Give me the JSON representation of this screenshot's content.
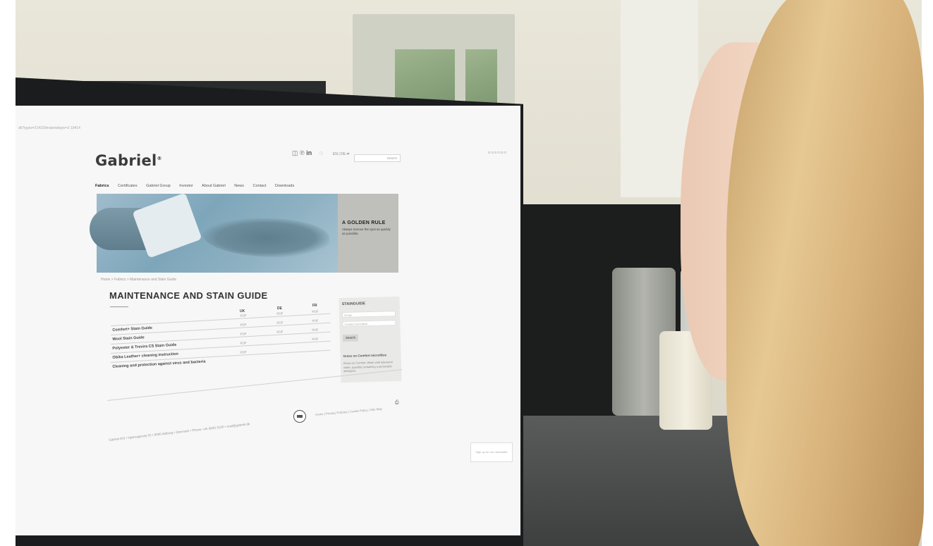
{
  "site": {
    "url": "dk?types=214318materialtype=2 19414",
    "brand": "Gabriel",
    "social_icons": [
      "instagram-icon",
      "pinterest-icon",
      "linkedin-icon"
    ],
    "lang": "EN | DE ⇄",
    "search_placeholder": "Search"
  },
  "nav": {
    "items": [
      "Fabrics",
      "Certificates",
      "Gabriel Group",
      "Investor",
      "About Gabriel",
      "News",
      "Contact",
      "Downloads"
    ]
  },
  "hero": {
    "title": "A GOLDEN RULE",
    "subtitle": "Always remove the spot as quickly as possible."
  },
  "breadcrumb": "Home  >  Fabrics  >  Maintenance and Stain Guide",
  "page_title": "MAINTENANCE AND STAIN GUIDE",
  "table": {
    "columns": [
      "UK",
      "DE",
      "FR"
    ],
    "rows": [
      {
        "name": "Comfort+ Stain Guide",
        "uk": "PDF",
        "de": "PDF",
        "fr": "PDF"
      },
      {
        "name": "Wool Stain Guide",
        "uk": "PDF",
        "de": "PDF",
        "fr": "PDF"
      },
      {
        "name": "Polyester & Trevira CS Stain Guide",
        "uk": "PDF",
        "de": "PDF",
        "fr": "PDF"
      },
      {
        "name": "Obika Leather+ cleaning instruction",
        "uk": "PDF",
        "de": "",
        "fr": "PDF"
      },
      {
        "name": "Cleaning and protection against virus and bacteria",
        "uk": "PDF",
        "de": "",
        "fr": ""
      }
    ]
  },
  "stainguide": {
    "title": "STAINGUIDE",
    "select1": "Grass",
    "select2": "Comfort microfibre",
    "button": "Search",
    "result_heading": "Grass on Comfort microfibre",
    "result_text": "Grass on Comfort: Wash with lukewarm water, possibly containing a perionable detergent."
  },
  "footer": {
    "address": "Gabriel A/S  •  Hjulmagervej 55  •  9000 Aalborg  •  Denmark  •  Phone +45 9630 3100  •  mail@gabriel.dk",
    "links": "Home   |   Privacy Policies   |   Cookie Policy   |   Site Map",
    "newsletter": "Sign up for our newsletter"
  },
  "colors": {
    "hero_blue": "#8fb2c3",
    "hero_panel": "#bfc0bc",
    "logo": "#3b3b3b"
  }
}
